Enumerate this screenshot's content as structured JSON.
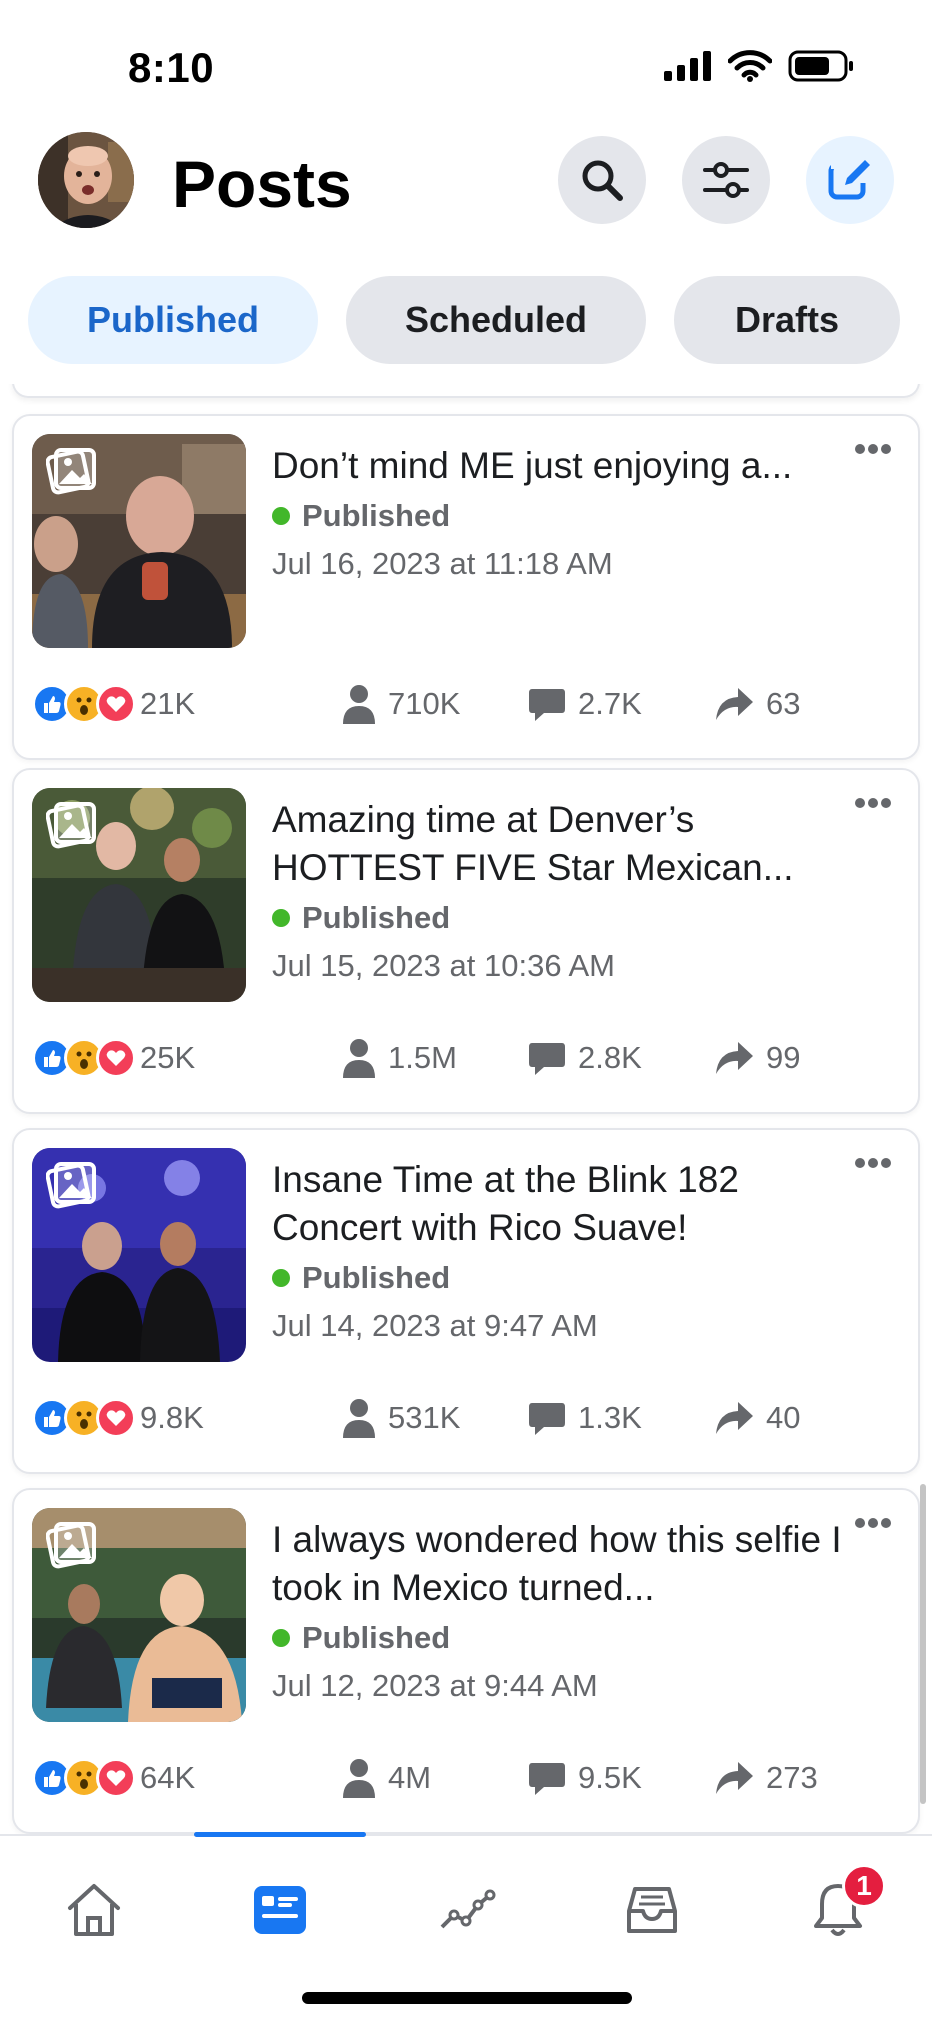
{
  "status_bar": {
    "time": "8:10"
  },
  "header": {
    "title": "Posts"
  },
  "tabs": [
    {
      "label": "Published",
      "active": true
    },
    {
      "label": "Scheduled",
      "active": false
    },
    {
      "label": "Drafts",
      "active": false
    }
  ],
  "posts": [
    {
      "title": "Don’t mind ME just enjoying a...",
      "status": "Published",
      "date": "Jul 16, 2023 at 11:18 AM",
      "reactions": "21K",
      "reach": "710K",
      "comments": "2.7K",
      "shares": "63"
    },
    {
      "title": "Amazing time at Denver’s HOTTEST FIVE Star Mexican...",
      "status": "Published",
      "date": "Jul 15, 2023 at 10:36 AM",
      "reactions": "25K",
      "reach": "1.5M",
      "comments": "2.8K",
      "shares": "99"
    },
    {
      "title": "Insane Time at the Blink 182 Concert with Rico Suave!",
      "status": "Published",
      "date": "Jul 14, 2023 at 9:47 AM",
      "reactions": "9.8K",
      "reach": "531K",
      "comments": "1.3K",
      "shares": "40"
    },
    {
      "title": "I always wondered how this selfie I took in Mexico turned...",
      "status": "Published",
      "date": "Jul 12, 2023 at 9:44 AM",
      "reactions": "64K",
      "reach": "4M",
      "comments": "9.5K",
      "shares": "273"
    }
  ],
  "nav": {
    "notifications_badge": "1"
  },
  "colors": {
    "accent": "#1877f2",
    "published_dot": "#42b72a",
    "badge": "#e41e3f"
  }
}
